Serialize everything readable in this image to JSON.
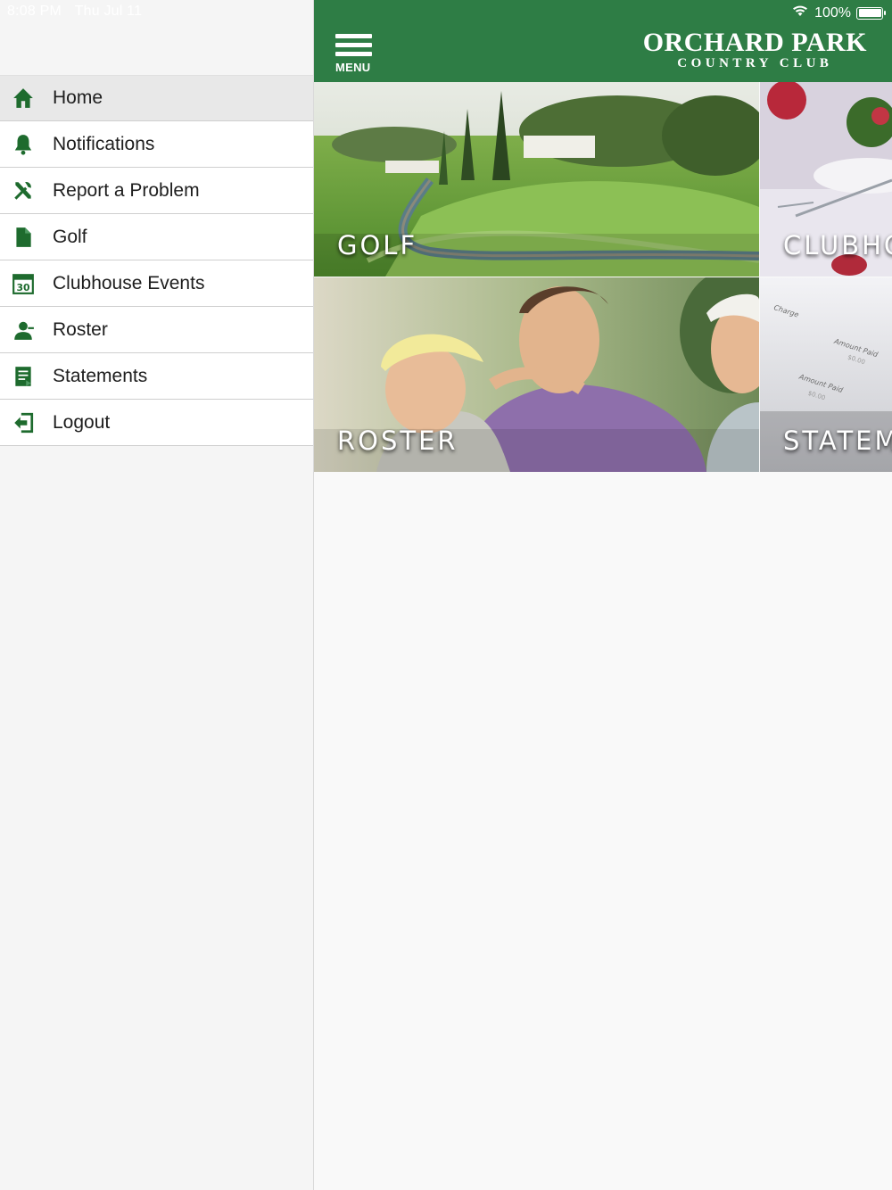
{
  "status_bar": {
    "time": "8:08 PM",
    "date": "Thu Jul 11",
    "battery": "100%"
  },
  "sidebar": {
    "items": [
      {
        "label": "Home",
        "icon": "home-icon"
      },
      {
        "label": "Notifications",
        "icon": "bell-icon"
      },
      {
        "label": "Report a Problem",
        "icon": "tools-icon"
      },
      {
        "label": "Golf",
        "icon": "document-icon"
      },
      {
        "label": "Clubhouse Events",
        "icon": "calendar-icon",
        "calendar_day": "30"
      },
      {
        "label": "Roster",
        "icon": "person-icon"
      },
      {
        "label": "Statements",
        "icon": "statement-icon"
      },
      {
        "label": "Logout",
        "icon": "logout-icon"
      }
    ]
  },
  "header": {
    "menu_label": "MENU",
    "brand_line1": "ORCHARD PARK",
    "brand_line2": "COUNTRY CLUB"
  },
  "tiles": {
    "golf": "GOLF",
    "clubhouse": "CLUBHOUSE",
    "roster": "ROSTER",
    "statements": "STATEMENTS",
    "statement_doc_text": [
      "Charge",
      "Amount Paid",
      "$0.00",
      "Amount Paid",
      "$0.00"
    ]
  },
  "colors": {
    "brand_green": "#2e7d45",
    "icon_green": "#1e6b2e"
  }
}
